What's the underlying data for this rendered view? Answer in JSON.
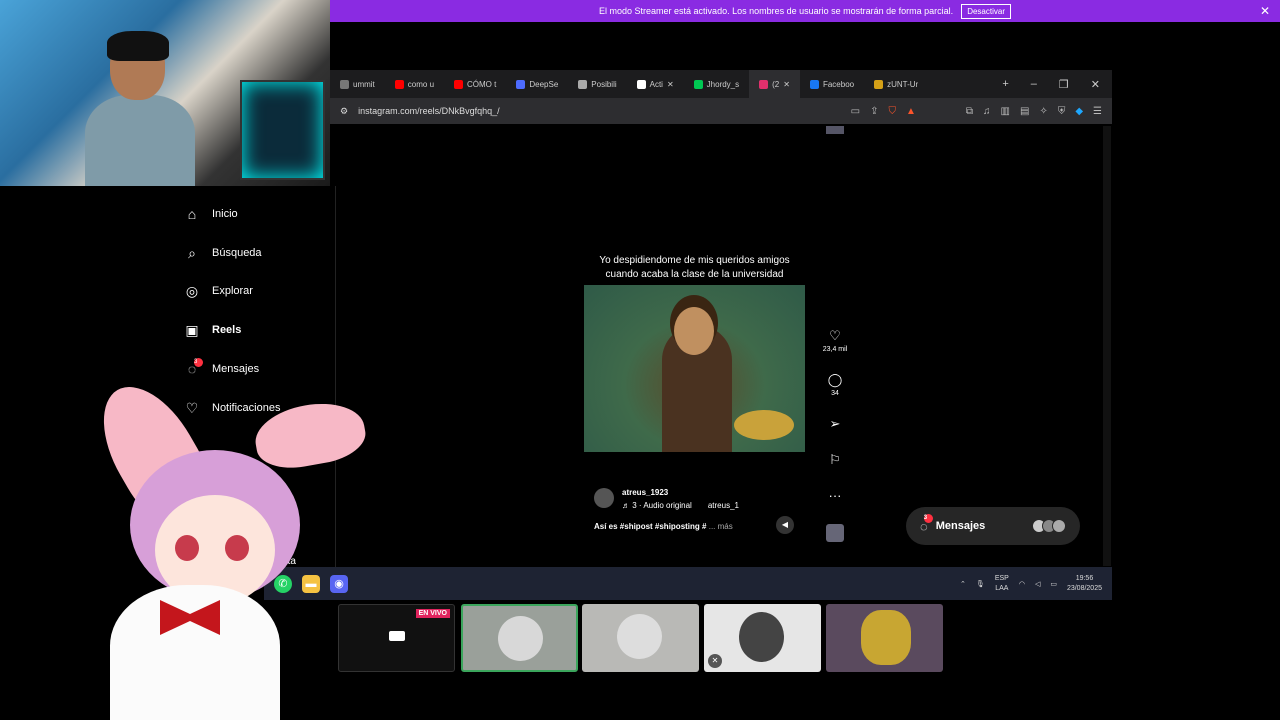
{
  "banner": {
    "text": "El modo Streamer está activado. Los nombres de usuario se mostrarán de forma parcial.",
    "button": "Desactivar"
  },
  "tabs": [
    {
      "label": "ummit",
      "color": "#777"
    },
    {
      "label": "como u",
      "color": "#ff0000"
    },
    {
      "label": "CÓMO t",
      "color": "#ff0000"
    },
    {
      "label": "DeepSe",
      "color": "#4d6bfe"
    },
    {
      "label": "Posibili",
      "color": "#aaa"
    },
    {
      "label": "Acti",
      "color": "#fff"
    },
    {
      "label": "Jhordy_s",
      "color": "#00c853"
    },
    {
      "label": "(2",
      "color": "#e1306c"
    },
    {
      "label": "Faceboo",
      "color": "#1877f2"
    },
    {
      "label": "zUNT-Ur",
      "color": "#d4a017"
    }
  ],
  "url": "instagram.com/reels/DNkBvgfqhq_/",
  "sidebar": {
    "items": [
      {
        "label": "Inicio",
        "icon": "home-icon",
        "glyph": "⌂"
      },
      {
        "label": "Búsqueda",
        "icon": "search-icon",
        "glyph": "⌕"
      },
      {
        "label": "Explorar",
        "icon": "compass-icon",
        "glyph": "◎"
      },
      {
        "label": "Reels",
        "icon": "reels-icon",
        "glyph": "▣"
      },
      {
        "label": "Mensajes",
        "icon": "messenger-icon",
        "glyph": "◌",
        "badge": "3"
      },
      {
        "label": "Notificaciones",
        "icon": "heart-icon",
        "glyph": "♡"
      }
    ],
    "footer_fragment": "eta"
  },
  "reel": {
    "caption": "Yo despidiendome de mis queridos amigos cuando acaba la clase de la universidad",
    "likes": "23,4 mil",
    "comments": "34",
    "author": "atreus_1923",
    "audio": "♬ 3 · Audio original",
    "audio_user": "atreus_1",
    "description": "Así es #shipost #shiposting #",
    "more": "... más"
  },
  "messages_pill": {
    "label": "Mensajes",
    "badge": "3"
  },
  "taskbar": {
    "lang_top": "ESP",
    "lang_bottom": "LAA",
    "time": "19:56",
    "date": "23/08/2025"
  },
  "stream": {
    "live_badge": "EN VIVO"
  }
}
